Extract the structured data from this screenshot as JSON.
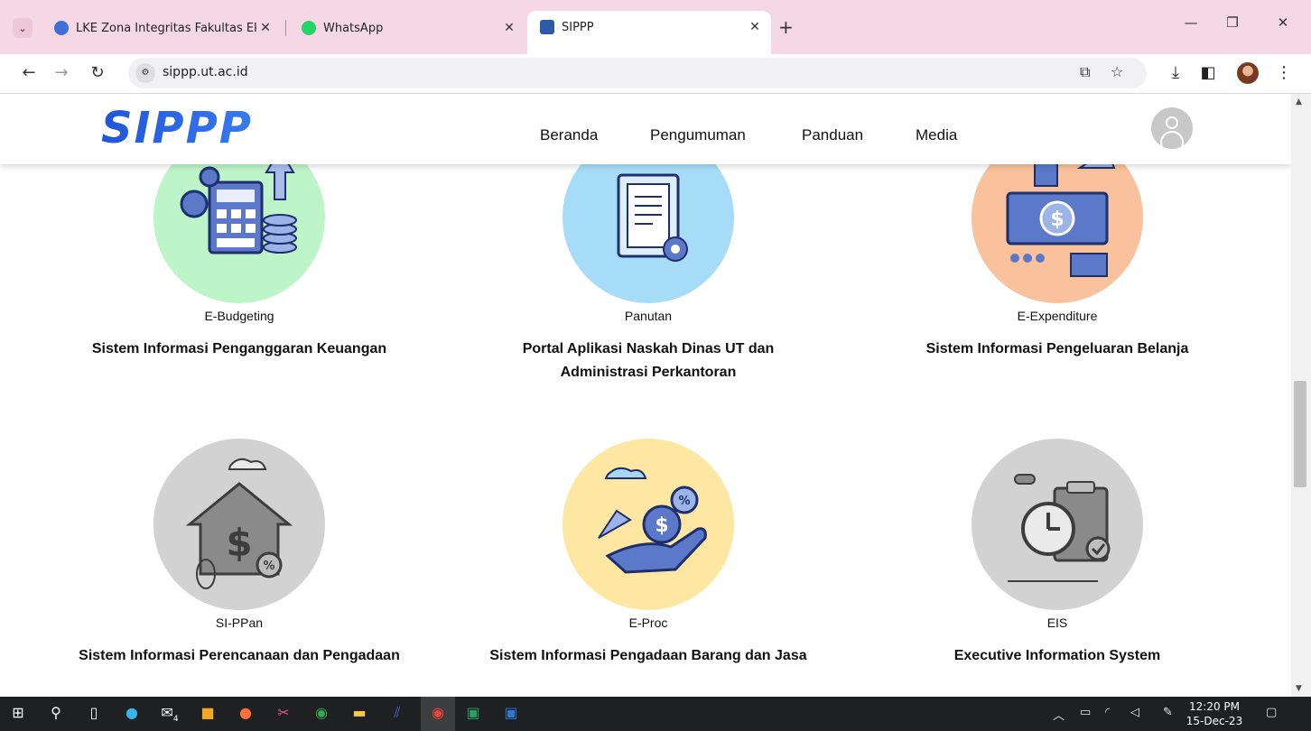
{
  "browser": {
    "tabs": [
      {
        "title": "LKE Zona Integritas Fakultas Ek",
        "favicon": "ut-logo-icon"
      },
      {
        "title": "WhatsApp",
        "favicon": "whatsapp-icon"
      },
      {
        "title": "SIPPP",
        "favicon": "ut-logo-icon",
        "active": true
      }
    ],
    "new_tab_label": "+",
    "address": "sippp.ut.ac.id"
  },
  "site": {
    "logo_text": "SIPPP",
    "menu": [
      "Beranda",
      "Pengumuman",
      "Panduan",
      "Media"
    ]
  },
  "apps": [
    {
      "name": "E-Budgeting",
      "description": "Sistem Informasi Penganggaran Keuangan",
      "color": "#bdf4c8",
      "icon": "calculator-money-icon"
    },
    {
      "name": "Panutan",
      "description": "Portal Aplikasi Naskah Dinas UT dan Administrasi Perkantoran",
      "color": "#a6dcf7",
      "icon": "document-certificate-icon"
    },
    {
      "name": "E-Expenditure",
      "description": "Sistem Informasi Pengeluaran Belanja",
      "color": "#f9c19c",
      "icon": "money-hands-icon"
    },
    {
      "name": "SI-PPan",
      "description": "Sistem Informasi Perencanaan dan Pengadaan",
      "color": "#d2d2d2",
      "icon": "house-money-icon"
    },
    {
      "name": "E-Proc",
      "description": "Sistem Informasi Pengadaan Barang dan Jasa",
      "color": "#fde7a2",
      "icon": "hand-coin-icon"
    },
    {
      "name": "EIS",
      "description": "Executive Information System",
      "color": "#d2d2d2",
      "icon": "clipboard-clock-icon"
    }
  ],
  "taskbar": {
    "mail_badge": "4",
    "time": "12:20 PM",
    "date": "15-Dec-23"
  }
}
